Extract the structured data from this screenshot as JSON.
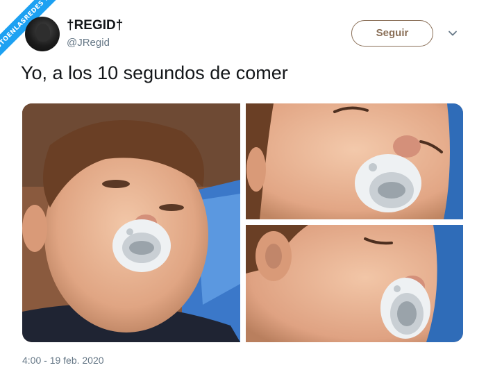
{
  "watermark": {
    "text": "VISTOENLASREDES .com"
  },
  "author": {
    "display_name": "†REGID†",
    "handle": "@JRegid",
    "avatar_icon": "user-avatar"
  },
  "actions": {
    "follow_label": "Seguir",
    "more_icon": "chevron-down-icon"
  },
  "tweet": {
    "text": "Yo, a los 10 segundos de comer",
    "timestamp": "4:00 - 19 feb. 2020"
  },
  "media": {
    "photos": [
      {
        "subject": "toddler-with-pacifier-awake"
      },
      {
        "subject": "toddler-with-pacifier-eyes-closing"
      },
      {
        "subject": "toddler-with-pacifier-asleep"
      }
    ]
  },
  "colors": {
    "text_primary": "#14171a",
    "text_secondary": "#657786",
    "follow_outline": "#8a6f57",
    "watermark_band": "#1da1f2"
  }
}
